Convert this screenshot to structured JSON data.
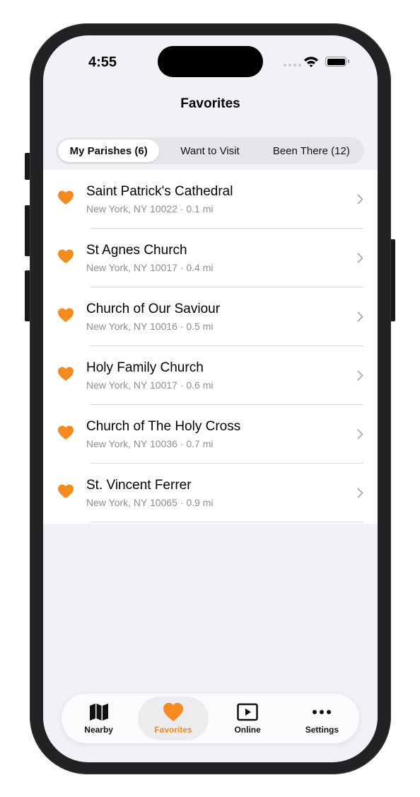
{
  "status_bar": {
    "time": "4:55"
  },
  "nav": {
    "title": "Favorites"
  },
  "segments": [
    {
      "label": "My Parishes (6)",
      "active": true
    },
    {
      "label": "Want to Visit",
      "active": false
    },
    {
      "label": "Been There (12)",
      "active": false
    }
  ],
  "parishes": [
    {
      "name": "Saint Patrick's Cathedral",
      "subtitle": "New York, NY 10022 · 0.1 mi"
    },
    {
      "name": "St Agnes Church",
      "subtitle": "New York, NY 10017 · 0.4 mi"
    },
    {
      "name": "Church of Our Saviour",
      "subtitle": "New York, NY 10016 · 0.5 mi"
    },
    {
      "name": "Holy Family Church",
      "subtitle": "New York, NY 10017 · 0.6 mi"
    },
    {
      "name": "Church of The Holy Cross",
      "subtitle": "New York, NY 10036 · 0.7 mi"
    },
    {
      "name": "St. Vincent Ferrer",
      "subtitle": "New York, NY 10065 · 0.9 mi"
    }
  ],
  "tabs": [
    {
      "label": "Nearby",
      "icon": "map-icon",
      "active": false
    },
    {
      "label": "Favorites",
      "icon": "heart-icon",
      "active": true
    },
    {
      "label": "Online",
      "icon": "play-icon",
      "active": false
    },
    {
      "label": "Settings",
      "icon": "ellipsis-icon",
      "active": false
    }
  ],
  "colors": {
    "accent": "#F58A1F",
    "subtitle": "#8E8E93",
    "background": "#F2F1F6"
  }
}
